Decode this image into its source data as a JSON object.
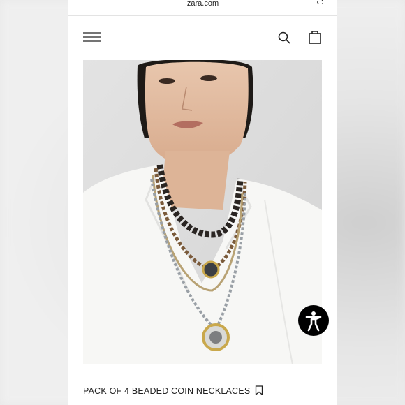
{
  "browser": {
    "url": "zara.com"
  },
  "header": {
    "menu_icon": "hamburger-menu-icon",
    "search_icon": "search-icon",
    "bag_icon": "shopping-bag-icon"
  },
  "product": {
    "image_icon": "product-photo",
    "name": "PACK OF 4 BEADED COIN NECKLACES",
    "bookmark_icon": "bookmark-icon"
  },
  "accessibility": {
    "icon": "accessibility-person-icon"
  },
  "colors": {
    "text": "#222222",
    "background": "#ffffff",
    "accent": "#000000"
  }
}
